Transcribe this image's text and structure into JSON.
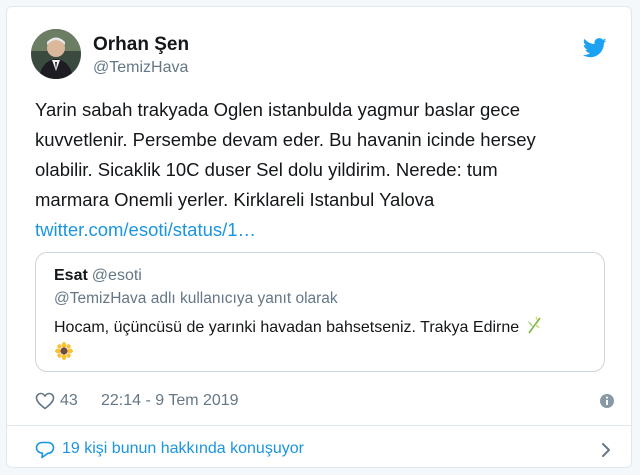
{
  "tweet": {
    "author_name": "Orhan Şen",
    "author_handle": "@TemizHava",
    "text_lines": [
      "Yarin sabah trakyada Oglen istanbulda yagmur baslar gece",
      "kuvvetlenir. Persembe devam eder. Bu havanin icinde hersey",
      "olabilir. Sicaklik 10C duser Sel dolu yildirim. Nerede: tum",
      "marmara Onemli yerler. Kirklareli Istanbul Yalova"
    ],
    "link_text": "twitter.com/esoti/status/1…",
    "like_count": "43",
    "timestamp": "22:14 - 9 Tem 2019",
    "conversation_text": "19 kişi bunun hakkında konuşuyor"
  },
  "quoted_tweet": {
    "author_name": "Esat",
    "author_handle": "@esoti",
    "reply_context": "@TemizHava adlı kullanıcıya yanıt olarak",
    "text": "Hocam, üçüncüsü de yarınki havadan bahsetseniz. Trakya Edirne"
  },
  "icons": {
    "brand": "twitter-bird-icon",
    "like": "heart-icon",
    "info": "info-icon",
    "conversation": "speech-bubble-icon",
    "chevron": "chevron-right-icon"
  },
  "colors": {
    "twitter_blue": "#1da1f2",
    "link_blue": "#1b95e0",
    "secondary_text": "#657786",
    "border": "#e1e8ed"
  }
}
